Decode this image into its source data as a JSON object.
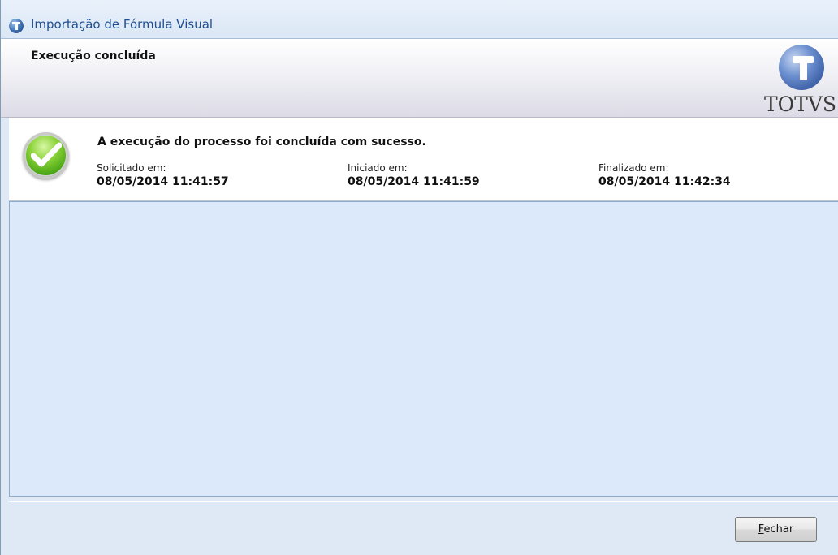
{
  "window": {
    "title": "Importação de Fórmula Visual"
  },
  "header": {
    "title": "Execução concluída",
    "logo_text": "TOTVS"
  },
  "status": {
    "icon": "success-check-icon",
    "message": "A execução do processo foi concluída com sucesso.",
    "requested": {
      "label": "Solicitado em:",
      "value": "08/05/2014 11:41:57"
    },
    "started": {
      "label": "Iniciado em:",
      "value": "08/05/2014 11:41:59"
    },
    "finished": {
      "label": "Finalizado em:",
      "value": "08/05/2014 11:42:34"
    }
  },
  "footer": {
    "close_mnemonic": "F",
    "close_rest": "echar"
  },
  "colors": {
    "title_text": "#1e4f91",
    "window_background": "#dfe9f5",
    "content_background": "#dce9fb",
    "success": "#4ea916"
  }
}
